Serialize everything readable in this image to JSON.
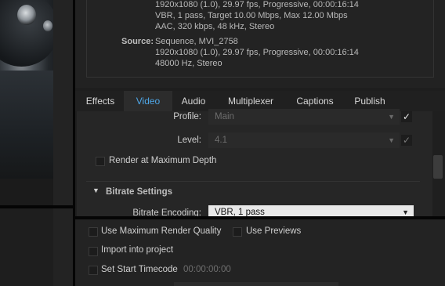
{
  "summary": {
    "output_lines": [
      "1920x1080 (1.0), 29.97 fps, Progressive, 00:00:16:14",
      "VBR, 1 pass, Target 10.00 Mbps, Max 12.00 Mbps",
      "AAC, 320 kbps, 48 kHz, Stereo"
    ],
    "source_label": "Source:",
    "source_lines": [
      "Sequence, MVI_2758",
      "1920x1080 (1.0), 29.97 fps, Progressive, 00:00:16:14",
      "48000 Hz, Stereo"
    ]
  },
  "tabs": [
    {
      "label": "Effects",
      "active": false
    },
    {
      "label": "Video",
      "active": true
    },
    {
      "label": "Audio",
      "active": false
    },
    {
      "label": "Multiplexer",
      "active": false
    },
    {
      "label": "Captions",
      "active": false
    },
    {
      "label": "Publish",
      "active": false
    }
  ],
  "video": {
    "profile_label": "Profile:",
    "profile_value": "Main",
    "level_label": "Level:",
    "level_value": "4.1",
    "render_max_depth_label": "Render at Maximum Depth",
    "bitrate_section_label": "Bitrate Settings",
    "bitrate_encoding_label": "Bitrate Encoding:",
    "bitrate_encoding_value": "VBR, 1 pass"
  },
  "bottom": {
    "max_render_quality_label": "Use Maximum Render Quality",
    "use_previews_label": "Use Previews",
    "import_label": "Import into project",
    "start_timecode_label": "Set Start Timecode",
    "start_timecode_value": "00:00:00:00"
  },
  "icons": {
    "checkmark": "check-icon",
    "dropdown": "chevron-down-icon",
    "disclosure": "triangle-down-icon"
  },
  "colors": {
    "accent": "#4ea7e8",
    "background": "#232323"
  }
}
